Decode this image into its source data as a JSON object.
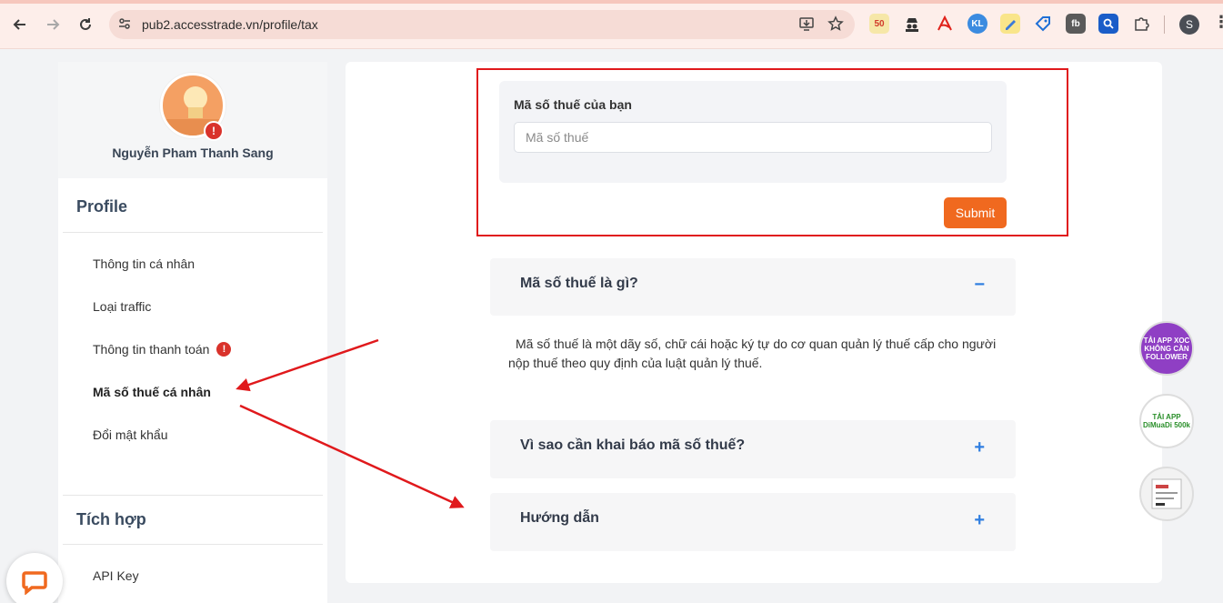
{
  "browser": {
    "url": "pub2.accesstrade.vn/profile/tax",
    "profile_initial": "S",
    "extension_text": [
      "50",
      "fb"
    ]
  },
  "sidebar": {
    "username": "Nguyễn Pham Thanh Sang",
    "profile_title": "Profile",
    "items": [
      {
        "label": "Thông tin cá nhân"
      },
      {
        "label": "Loại traffic"
      },
      {
        "label": "Thông tin thanh toán",
        "warning": "!"
      },
      {
        "label": "Mã số thuế cá nhân",
        "active": true
      },
      {
        "label": "Đổi mật khẩu"
      }
    ],
    "integration_title": "Tích hợp",
    "integration_items": [
      {
        "label": "API Key"
      }
    ],
    "avatar_badge": "!"
  },
  "tax_form": {
    "label": "Mã số thuế của bạn",
    "placeholder": "Mã số thuế",
    "value": "",
    "submit_label": "Submit"
  },
  "faq": [
    {
      "title": "Mã số thuế là gì?",
      "toggle": "−",
      "expanded": true,
      "body": "Mã số thuế là một dãy số, chữ cái hoặc ký tự do cơ quan quản lý thuế cấp cho người nộp thuế theo quy định của luật quản lý thuế."
    },
    {
      "title": "Vì sao cần khai báo mã số thuế?",
      "toggle": "+",
      "expanded": false
    },
    {
      "title": "Hướng dẫn",
      "toggle": "+",
      "expanded": false
    }
  ],
  "promos": [
    {
      "text": "TẢI APP XOC KHÔNG CẦN FOLLOWER"
    },
    {
      "text": "TẢI APP DiMuaDi 500k"
    },
    {
      "text": ""
    }
  ],
  "colors": {
    "accent": "#f0691f",
    "highlight": "#e0191c",
    "link": "#2f7ee0",
    "warning": "#d9322b"
  }
}
